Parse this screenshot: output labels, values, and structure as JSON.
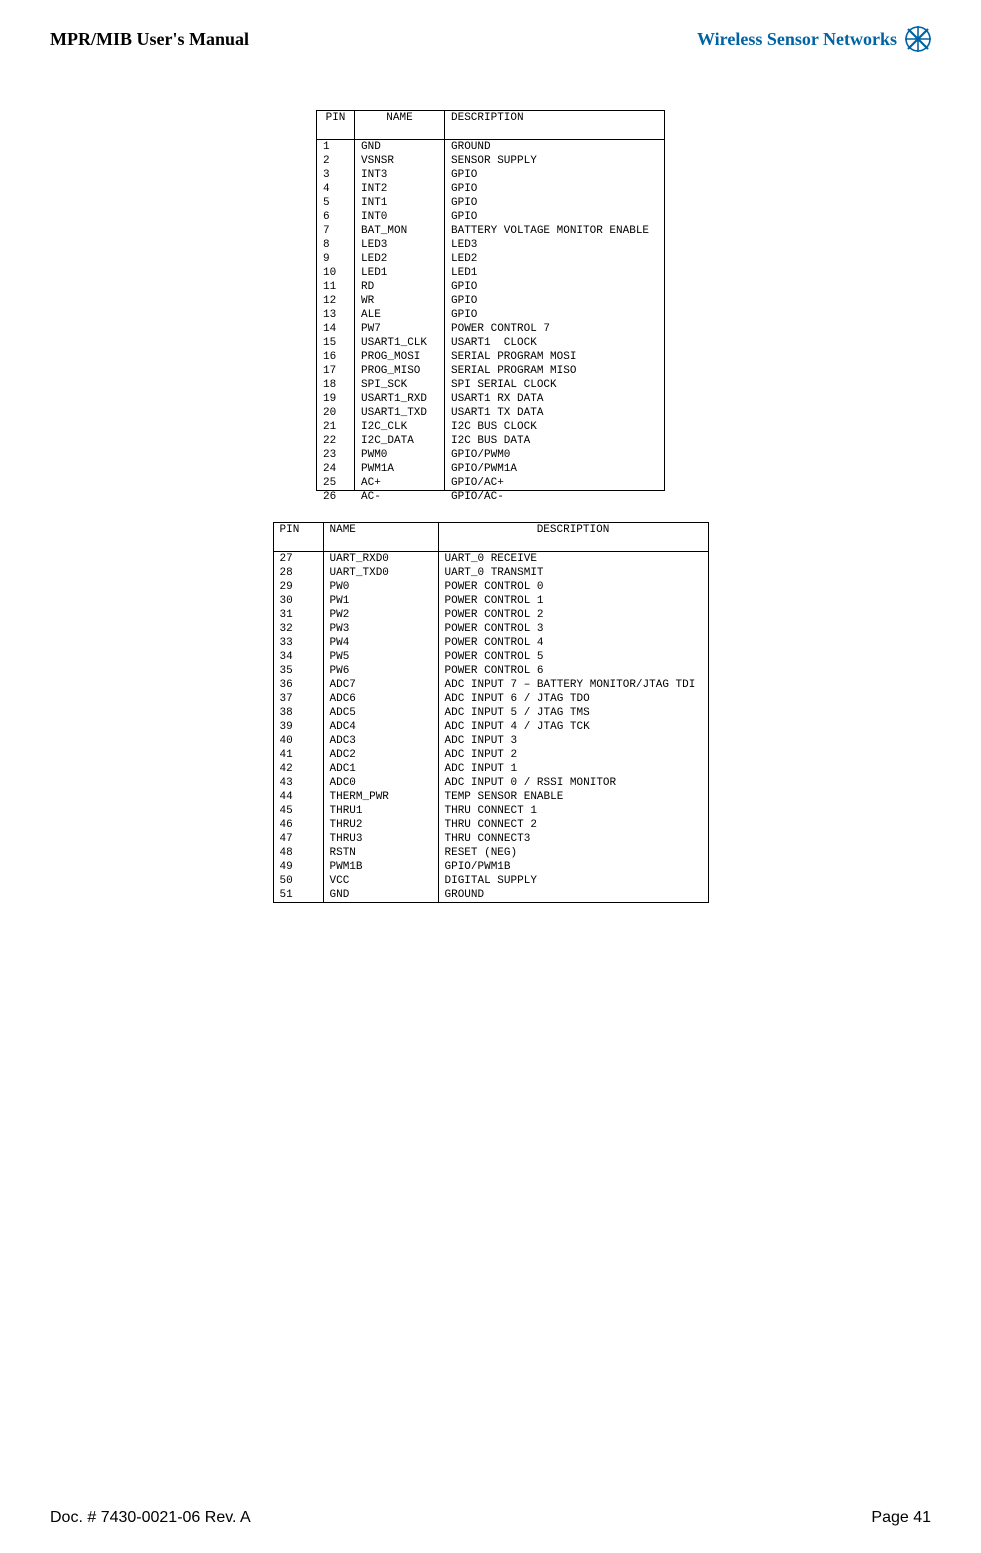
{
  "header": {
    "left": "MPR/MIB User's Manual",
    "right": "Wireless Sensor Networks"
  },
  "footer": {
    "left": "Doc. # 7430-0021-06 Rev. A",
    "right": "Page 41"
  },
  "table1": {
    "headers": [
      "PIN",
      "NAME",
      "DESCRIPTION"
    ],
    "rows": [
      [
        "1",
        "GND",
        "GROUND"
      ],
      [
        "2",
        "VSNSR",
        "SENSOR SUPPLY"
      ],
      [
        "3",
        "INT3",
        "GPIO"
      ],
      [
        "4",
        "INT2",
        "GPIO"
      ],
      [
        "5",
        "INT1",
        "GPIO"
      ],
      [
        "6",
        "INT0",
        "GPIO"
      ],
      [
        "7",
        "BAT_MON",
        "BATTERY VOLTAGE MONITOR ENABLE"
      ],
      [
        "8",
        "LED3",
        "LED3"
      ],
      [
        "9",
        "LED2",
        "LED2"
      ],
      [
        "10",
        "LED1",
        "LED1"
      ],
      [
        "11",
        "RD",
        "GPIO"
      ],
      [
        "12",
        "WR",
        "GPIO"
      ],
      [
        "13",
        "ALE",
        "GPIO"
      ],
      [
        "14",
        "PW7",
        "POWER CONTROL 7"
      ],
      [
        "15",
        "USART1_CLK",
        "USART1  CLOCK"
      ],
      [
        "16",
        "PROG_MOSI",
        "SERIAL PROGRAM MOSI"
      ],
      [
        "17",
        "PROG_MISO",
        "SERIAL PROGRAM MISO"
      ],
      [
        "18",
        "SPI_SCK",
        "SPI SERIAL CLOCK"
      ],
      [
        "19",
        "USART1_RXD",
        "USART1 RX DATA"
      ],
      [
        "20",
        "USART1_TXD",
        "USART1 TX DATA"
      ],
      [
        "21",
        "I2C_CLK",
        "I2C BUS CLOCK"
      ],
      [
        "22",
        "I2C_DATA",
        "I2C BUS DATA"
      ],
      [
        "23",
        "PWM0",
        "GPIO/PWM0"
      ],
      [
        "24",
        "PWM1A",
        "GPIO/PWM1A"
      ],
      [
        "25",
        "AC+",
        "GPIO/AC+"
      ]
    ],
    "overflow": [
      "26",
      "AC-",
      "GPIO/AC-"
    ]
  },
  "table2": {
    "headers": [
      "PIN",
      "NAME",
      "DESCRIPTION"
    ],
    "rows": [
      [
        "27",
        "UART_RXD0",
        "UART_0 RECEIVE"
      ],
      [
        "28",
        "UART_TXD0",
        "UART_0 TRANSMIT"
      ],
      [
        "29",
        "PW0",
        "POWER CONTROL 0"
      ],
      [
        "30",
        "PW1",
        "POWER CONTROL 1"
      ],
      [
        "31",
        "PW2",
        "POWER CONTROL 2"
      ],
      [
        "32",
        "PW3",
        "POWER CONTROL 3"
      ],
      [
        "33",
        "PW4",
        "POWER CONTROL 4"
      ],
      [
        "34",
        "PW5",
        "POWER CONTROL 5"
      ],
      [
        "35",
        "PW6",
        "POWER CONTROL 6"
      ],
      [
        "36",
        "ADC7",
        "ADC INPUT 7 – BATTERY MONITOR/JTAG TDI"
      ],
      [
        "37",
        "ADC6",
        "ADC INPUT 6 / JTAG TDO"
      ],
      [
        "38",
        "ADC5",
        "ADC INPUT 5 / JTAG TMS"
      ],
      [
        "39",
        "ADC4",
        "ADC INPUT 4 / JTAG TCK"
      ],
      [
        "40",
        "ADC3",
        "ADC INPUT 3"
      ],
      [
        "41",
        "ADC2",
        "ADC INPUT 2"
      ],
      [
        "42",
        "ADC1",
        "ADC INPUT 1"
      ],
      [
        "43",
        "ADC0",
        "ADC INPUT 0 / RSSI MONITOR"
      ],
      [
        "44",
        "THERM_PWR",
        "TEMP SENSOR ENABLE"
      ],
      [
        "45",
        "THRU1",
        "THRU CONNECT 1"
      ],
      [
        "46",
        "THRU2",
        "THRU CONNECT 2"
      ],
      [
        "47",
        "THRU3",
        "THRU CONNECT3"
      ],
      [
        "48",
        "RSTN",
        "RESET (NEG)"
      ],
      [
        "49",
        "PWM1B",
        "GPIO/PWM1B"
      ],
      [
        "50",
        "VCC",
        "DIGITAL SUPPLY"
      ],
      [
        "51",
        "GND",
        "GROUND"
      ]
    ]
  }
}
